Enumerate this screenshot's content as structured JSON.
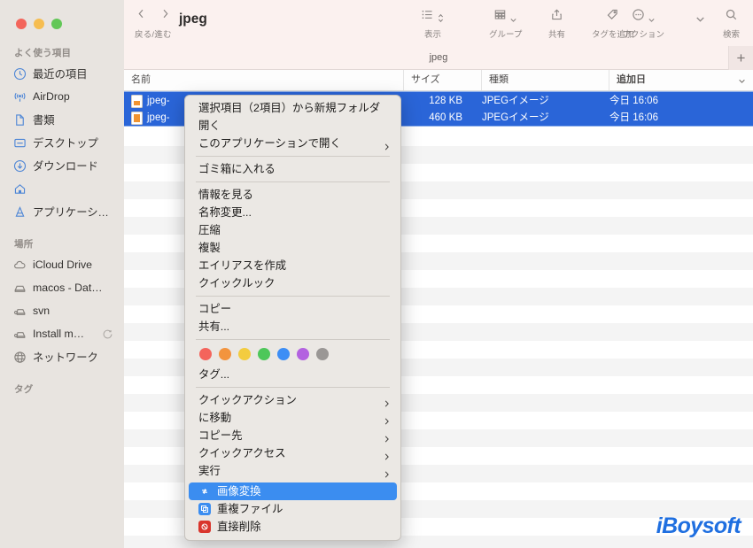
{
  "window": {
    "title": "jpeg",
    "traffic_lights": [
      {
        "name": "close",
        "color": "#f3655b"
      },
      {
        "name": "minimize",
        "color": "#f6bd50"
      },
      {
        "name": "zoom",
        "color": "#62c757"
      }
    ]
  },
  "toolbar": {
    "nav_caption": "戻る/進む",
    "items": [
      {
        "name": "view",
        "label": "表示",
        "icon": "list-view-icon"
      },
      {
        "name": "group",
        "label": "グループ",
        "icon": "grid-group-icon"
      },
      {
        "name": "share",
        "label": "共有",
        "icon": "share-icon"
      },
      {
        "name": "add-tag",
        "label": "タグを追加",
        "icon": "tag-icon"
      },
      {
        "name": "action",
        "label": "アクション",
        "icon": "ellipsis-circle-icon"
      },
      {
        "name": "search",
        "label": "検索",
        "icon": "search-icon"
      }
    ]
  },
  "pathbar": {
    "current": "jpeg",
    "add_label": "+"
  },
  "columns": [
    {
      "key": "name",
      "label": "名前",
      "sorted": false
    },
    {
      "key": "size",
      "label": "サイズ",
      "sorted": false
    },
    {
      "key": "kind",
      "label": "種類",
      "sorted": false
    },
    {
      "key": "date",
      "label": "追加日",
      "sorted": true
    }
  ],
  "files": [
    {
      "name": "jpeg-",
      "size": "128 KB",
      "kind": "JPEGイメージ",
      "date": "今日 16:06",
      "selected": true
    },
    {
      "name": "jpeg-",
      "size": "460 KB",
      "kind": "JPEGイメージ",
      "date": "今日 16:06",
      "selected": true
    }
  ],
  "sidebar": {
    "sections": [
      {
        "title": "よく使う項目",
        "items": [
          {
            "label": "最近の項目",
            "icon": "clock-icon"
          },
          {
            "label": "AirDrop",
            "icon": "airdrop-icon"
          },
          {
            "label": "書類",
            "icon": "document-icon"
          },
          {
            "label": "デスクトップ",
            "icon": "desktop-icon"
          },
          {
            "label": "ダウンロード",
            "icon": "download-icon"
          },
          {
            "label": "",
            "icon": "home-icon"
          },
          {
            "label": "アプリケーシ…",
            "icon": "applications-icon"
          }
        ]
      },
      {
        "title": "場所",
        "items": [
          {
            "label": "iCloud Drive",
            "icon": "icloud-icon"
          },
          {
            "label": "macos - Dat…",
            "icon": "internal-drive-icon"
          },
          {
            "label": "svn",
            "icon": "external-drive-icon"
          },
          {
            "label": "Install m…",
            "icon": "external-drive-icon",
            "eject": true
          },
          {
            "label": "ネットワーク",
            "icon": "network-globe-icon"
          }
        ]
      },
      {
        "title": "タグ",
        "items": []
      }
    ]
  },
  "context_menu": {
    "groups": [
      [
        {
          "label": "選択項目（2項目）から新規フォルダ",
          "name": "new-folder-with-selection"
        },
        {
          "label": "開く",
          "name": "open"
        },
        {
          "label": "このアプリケーションで開く",
          "name": "open-with",
          "submenu": true
        }
      ],
      [
        {
          "label": "ゴミ箱に入れる",
          "name": "move-to-trash"
        }
      ],
      [
        {
          "label": "情報を見る",
          "name": "get-info"
        },
        {
          "label": "名称変更...",
          "name": "rename"
        },
        {
          "label": "圧縮",
          "name": "compress"
        },
        {
          "label": "複製",
          "name": "duplicate"
        },
        {
          "label": "エイリアスを作成",
          "name": "make-alias"
        },
        {
          "label": "クイックルック",
          "name": "quick-look"
        }
      ],
      [
        {
          "label": "コピー",
          "name": "copy"
        },
        {
          "label": "共有...",
          "name": "share"
        }
      ]
    ],
    "tag_colors": [
      "#f4645c",
      "#f2943e",
      "#f3cc3f",
      "#4ec75a",
      "#3d8ef5",
      "#b362e0",
      "#9a9795"
    ],
    "tags_label": "タグ...",
    "submenu_group": [
      {
        "label": "クイックアクション",
        "name": "quick-actions",
        "submenu": true
      },
      {
        "label": "に移動",
        "name": "move-to",
        "submenu": true
      },
      {
        "label": "コピー先",
        "name": "copy-to",
        "submenu": true
      },
      {
        "label": "クイックアクセス",
        "name": "quick-access",
        "submenu": true
      },
      {
        "label": "実行",
        "name": "execute",
        "submenu": true
      }
    ],
    "app_group": [
      {
        "label": "画像変換",
        "name": "image-convert",
        "icon_color": "#3b8df0",
        "highlighted": true
      },
      {
        "label": "重複ファイル",
        "name": "duplicate-files",
        "icon_color": "#3b8df0",
        "highlighted": false
      },
      {
        "label": "直接削除",
        "name": "direct-delete",
        "icon_color": "#d9352c",
        "highlighted": false
      }
    ]
  },
  "watermark": {
    "text": "iBoysoft",
    "color": "#1f6fe0"
  }
}
